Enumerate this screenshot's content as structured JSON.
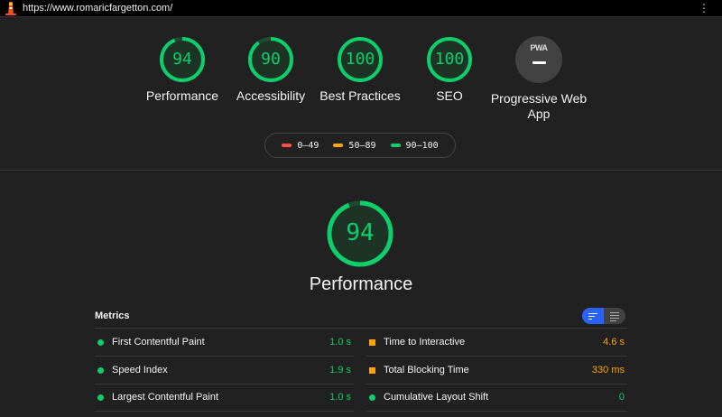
{
  "browser": {
    "url": "https://www.romaricfargetton.com/",
    "logo_icon": "lighthouse-icon",
    "menu_icon": "kebab-menu-icon"
  },
  "colors": {
    "pass": "#0cce6b",
    "average": "#ffa400",
    "fail": "#ff4e42",
    "background": "#212121"
  },
  "summary": {
    "categories": [
      {
        "label": "Performance",
        "score": "94"
      },
      {
        "label": "Accessibility",
        "score": "90"
      },
      {
        "label": "Best Practices",
        "score": "100"
      },
      {
        "label": "SEO",
        "score": "100"
      }
    ],
    "pwa": {
      "badge": "PWA",
      "label": "Progressive Web App"
    }
  },
  "legend": {
    "fail": "0–49",
    "average": "50–89",
    "pass": "90–100"
  },
  "performance": {
    "score": "94",
    "title": "Performance"
  },
  "metrics": {
    "title": "Metrics",
    "left": [
      {
        "name": "First Contentful Paint",
        "value": "1.0 s",
        "status": "pass"
      },
      {
        "name": "Speed Index",
        "value": "1.9 s",
        "status": "pass"
      },
      {
        "name": "Largest Contentful Paint",
        "value": "1.0 s",
        "status": "pass"
      }
    ],
    "right": [
      {
        "name": "Time to Interactive",
        "value": "4.6 s",
        "status": "average"
      },
      {
        "name": "Total Blocking Time",
        "value": "330 ms",
        "status": "average"
      },
      {
        "name": "Cumulative Layout Shift",
        "value": "0",
        "status": "pass"
      }
    ]
  }
}
